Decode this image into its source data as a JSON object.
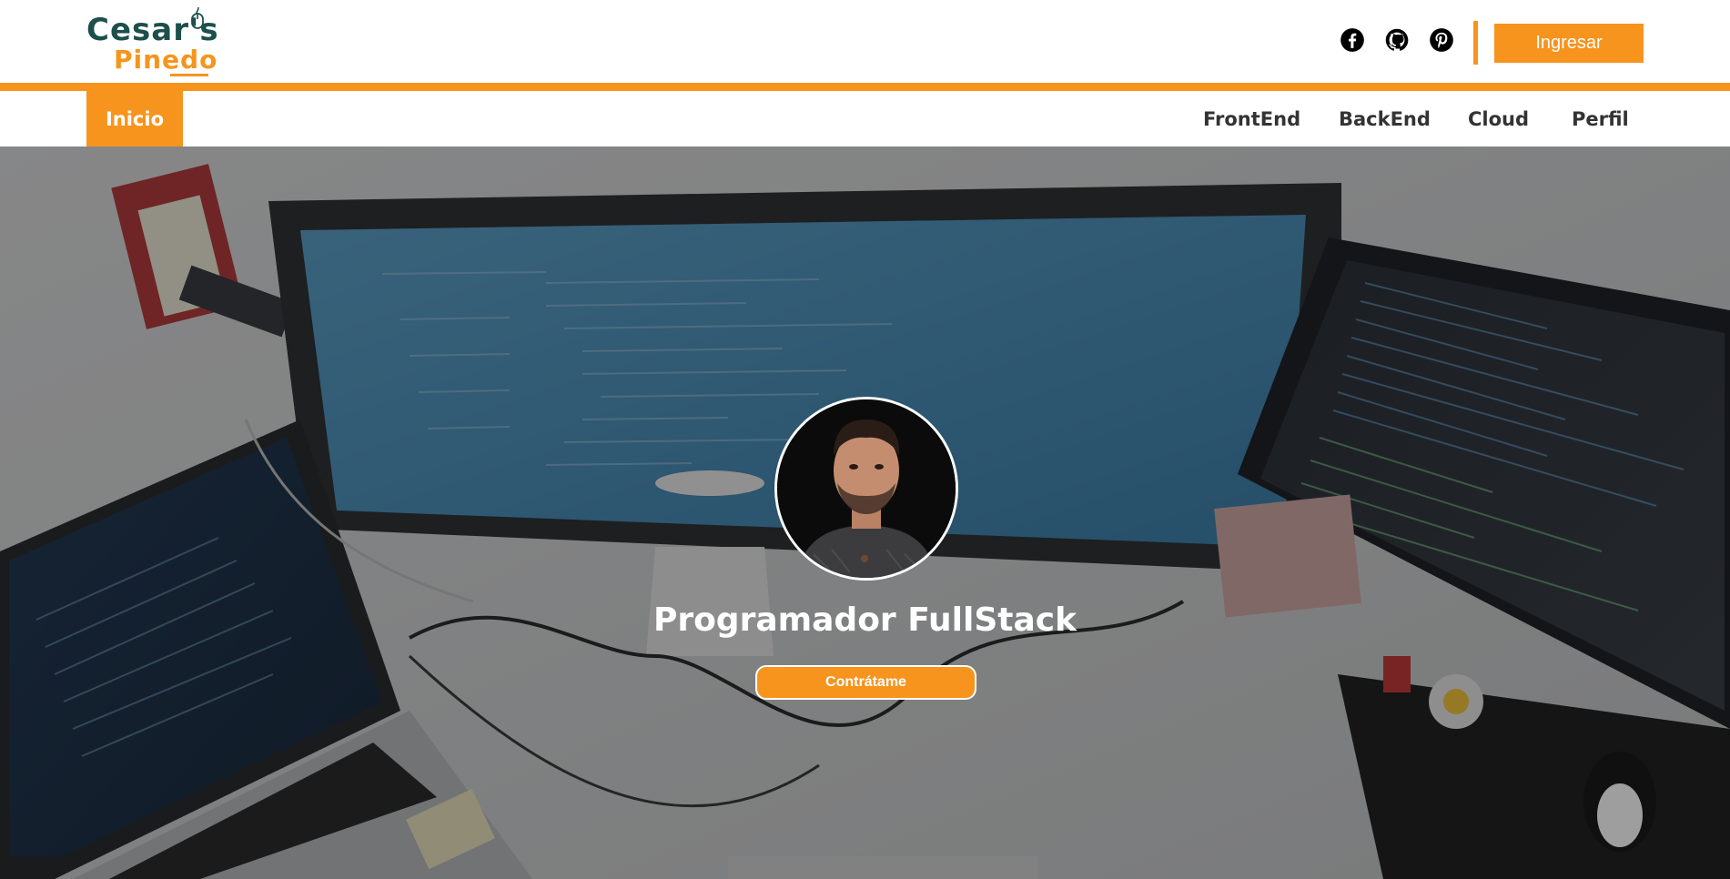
{
  "brand": {
    "logo_line1": "Cesar's",
    "logo_line2": "Pinedo",
    "primary_color": "#1d4f4b",
    "accent_color": "#f7941d"
  },
  "header": {
    "social_icons": [
      "facebook-icon",
      "github-icon",
      "pinterest-icon"
    ],
    "login_label": "Ingresar"
  },
  "nav": {
    "home_label": "Inicio",
    "items": [
      {
        "label": "FrontEnd"
      },
      {
        "label": "BackEnd"
      },
      {
        "label": "Cloud"
      },
      {
        "label": "Perfil"
      }
    ]
  },
  "hero": {
    "title": "Programador FullStack",
    "cta_label": "Contrátame",
    "background": "desk-with-monitors-photo",
    "avatar": "profile-photo"
  }
}
